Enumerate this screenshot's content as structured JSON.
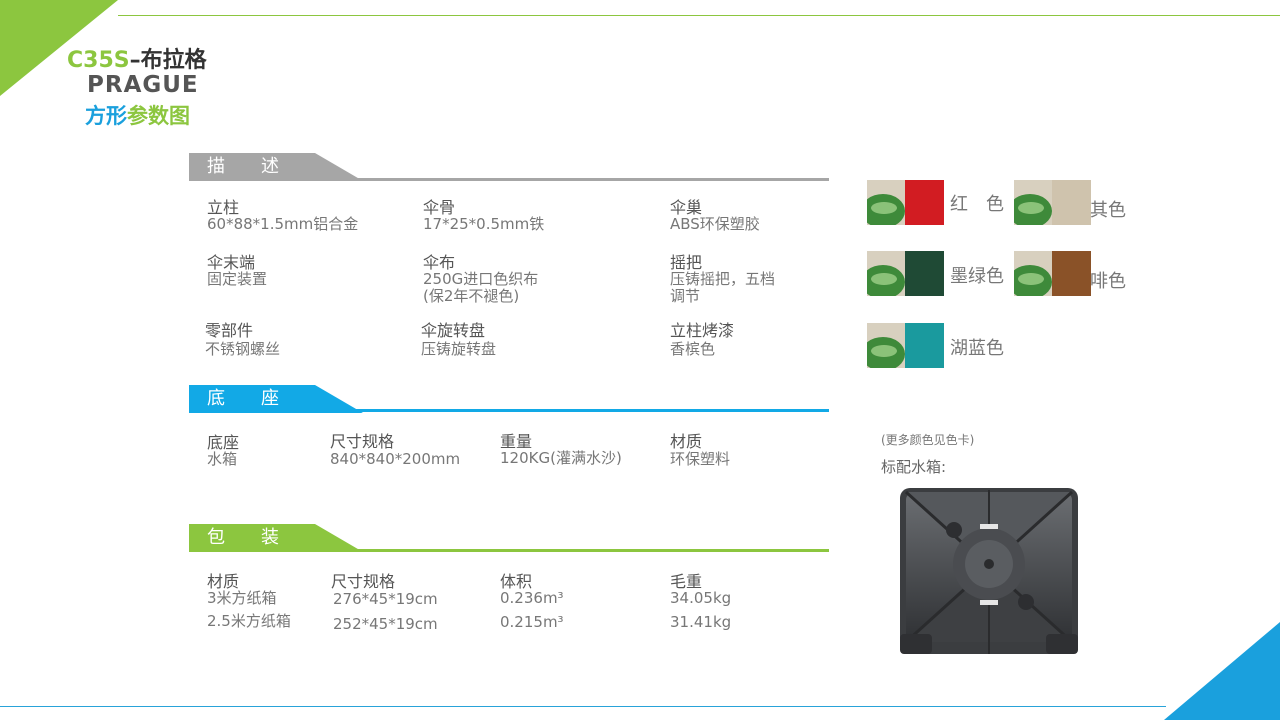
{
  "header": {
    "model": "C35S",
    "name_cn": "–布拉格",
    "name_en": "PRAGUE",
    "subtitle_blue": "方形",
    "subtitle_green": "参数图"
  },
  "sections": {
    "description": {
      "title": "描　　述",
      "items": [
        {
          "label": "立柱",
          "value": "60*88*1.5mm铝合金"
        },
        {
          "label": "伞骨",
          "value": "17*25*0.5mm铁"
        },
        {
          "label": "伞巢",
          "value": "ABS环保塑胶"
        },
        {
          "label": "伞末端",
          "value": "固定装置"
        },
        {
          "label": "伞布",
          "value": "250G进口色织布",
          "value2": "(保2年不褪色)"
        },
        {
          "label": "摇把",
          "value": "压铸摇把，五档",
          "value2": "调节"
        },
        {
          "label": "零部件",
          "value": "不锈钢螺丝"
        },
        {
          "label": "伞旋转盘",
          "value": "压铸旋转盘"
        },
        {
          "label": "立柱烤漆",
          "value": "香槟色"
        }
      ]
    },
    "base": {
      "title": "底　　座",
      "items": [
        {
          "label": "底座",
          "value": "水箱"
        },
        {
          "label": "尺寸规格",
          "value": "840*840*200mm"
        },
        {
          "label": "重量",
          "value": "120KG(灌满水沙)"
        },
        {
          "label": "材质",
          "value": "环保塑料"
        }
      ]
    },
    "packing": {
      "title": "包　　装",
      "headers": [
        "材质",
        "尺寸规格",
        "体积",
        "毛重"
      ],
      "rows": [
        [
          "3米方纸箱",
          "276*45*19cm",
          "0.236m³",
          "34.05kg"
        ],
        [
          "2.5米方纸箱",
          "252*45*19cm",
          "0.215m³",
          "31.41kg"
        ]
      ]
    }
  },
  "swatches": [
    {
      "label": "红　色",
      "color": "#d21c22"
    },
    {
      "label": "其色",
      "color": "#cfc3ad"
    },
    {
      "label": "墨绿色",
      "color": "#1f4a35"
    },
    {
      "label": "啡色",
      "color": "#8a5228"
    },
    {
      "label": "湖蓝色",
      "color": "#1a9a9e"
    }
  ],
  "notes": {
    "more_colors": "(更多颜色见色卡)",
    "standard_tank": "标配水箱:"
  },
  "colors": {
    "green": "#8cc63f",
    "blue": "#1aa0dd",
    "gray": "#a6a6a6"
  }
}
